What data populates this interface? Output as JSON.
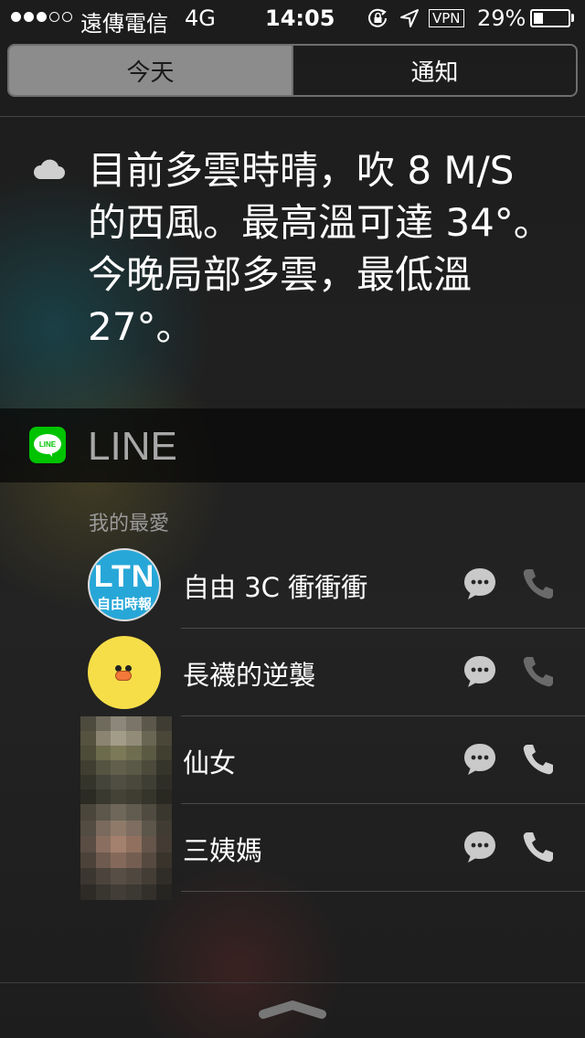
{
  "status_bar": {
    "carrier": "遠傳電信",
    "network": "4G",
    "time": "14:05",
    "vpn": "VPN",
    "battery": "29%",
    "battery_level": 0.29,
    "signal_bars_filled": 3,
    "signal_bars_total": 5
  },
  "tabs": [
    {
      "label": "今天",
      "selected": true
    },
    {
      "label": "通知",
      "selected": false
    }
  ],
  "weather": {
    "icon": "cloud-icon",
    "text": "目前多雲時晴，吹 8 M/S 的西風。最高溫可達 34°。今晚局部多雲，最低溫 27°。"
  },
  "line_widget": {
    "title": "LINE",
    "logo_text": "LINE",
    "favorites_heading": "我的最愛",
    "contacts": [
      {
        "name": "自由 3C 衝衝衝",
        "avatar_text": "LTN",
        "avatar_subtext": "自由時報",
        "call_enabled": false
      },
      {
        "name": "長襪的逆襲",
        "call_enabled": false
      },
      {
        "name": "仙女",
        "call_enabled": true
      },
      {
        "name": "三姨媽",
        "call_enabled": true
      }
    ]
  },
  "colors": {
    "line_green": "#00c300",
    "ltn_blue": "#27a7d8",
    "sally_yellow": "#f6de49"
  }
}
